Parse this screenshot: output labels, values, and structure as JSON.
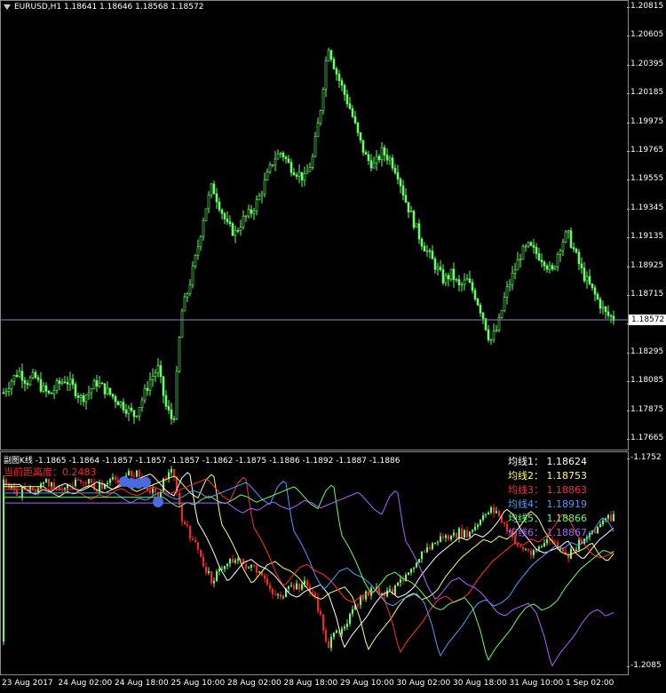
{
  "chart_title": "EURUSD,H1  1.18641 1.18646 1.18568 1.18572",
  "current_price": "1.18572",
  "price_scale": [
    "1.20815",
    "1.20605",
    "1.20395",
    "1.20185",
    "1.19975",
    "1.19765",
    "1.19555",
    "1.19345",
    "1.19135",
    "1.18925",
    "1.18715",
    "1.18505",
    "1.18295",
    "1.18085",
    "1.17875",
    "1.17665"
  ],
  "indicator_title": "副图K线 -1.1865 -1.1864 -1.1857 -1.1857 -1.1857 -1.1862 -1.1875 -1.1886 -1.1892 -1.1887 -1.1886",
  "distance_label": "当前距离度：0.2483",
  "sub_scale": {
    "top": "-1.1752",
    "bottom": "-1.2085"
  },
  "ma_legend": [
    {
      "label": "均线1：",
      "value": "1.18624",
      "color": "#ffffff"
    },
    {
      "label": "均线2：",
      "value": "1.18753",
      "color": "#ffff66"
    },
    {
      "label": "均线3：",
      "value": "1.18863",
      "color": "#ff3030"
    },
    {
      "label": "均线4：",
      "value": "1.18919",
      "color": "#4a9eff"
    },
    {
      "label": "均线5：",
      "value": "1.18866",
      "color": "#66ff66"
    },
    {
      "label": "均线6：",
      "value": "1.18867",
      "color": "#b060ff"
    }
  ],
  "time_labels": [
    "23 Aug 2017",
    "24 Aug 02:00",
    "24 Aug 18:00",
    "25 Aug 10:00",
    "28 Aug 02:00",
    "28 Aug 18:00",
    "29 Aug 10:00",
    "30 Aug 02:00",
    "30 Aug 18:00",
    "31 Aug 10:00",
    "1 Sep 02:00"
  ],
  "chart_data": {
    "type": "candlestick",
    "symbol": "EURUSD",
    "timeframe": "H1",
    "ylim": [
      1.1762,
      1.2087
    ],
    "close_path": [
      1.1802,
      1.1811,
      1.1818,
      1.181,
      1.1814,
      1.1805,
      1.18,
      1.1808,
      1.1812,
      1.1806,
      1.1798,
      1.1802,
      1.181,
      1.1805,
      1.18,
      1.1795,
      1.179,
      1.1785,
      1.1798,
      1.1812,
      1.182,
      1.1792,
      1.178,
      1.186,
      1.188,
      1.1905,
      1.1935,
      1.1955,
      1.194,
      1.1925,
      1.192,
      1.193,
      1.1935,
      1.1945,
      1.196,
      1.1975,
      1.198,
      1.197,
      1.1965,
      1.196,
      1.1975,
      1.201,
      1.206,
      1.204,
      1.2025,
      1.201,
      1.199,
      1.1975,
      1.197,
      1.198,
      1.1975,
      1.1965,
      1.1945,
      1.193,
      1.1915,
      1.1905,
      1.1895,
      1.1885,
      1.189,
      1.188,
      1.1885,
      1.1875,
      1.186,
      1.184,
      1.185,
      1.1875,
      1.189,
      1.1905,
      1.191,
      1.1905,
      1.19,
      1.189,
      1.191,
      1.192,
      1.1905,
      1.189,
      1.188,
      1.187,
      1.186,
      1.1857
    ]
  }
}
